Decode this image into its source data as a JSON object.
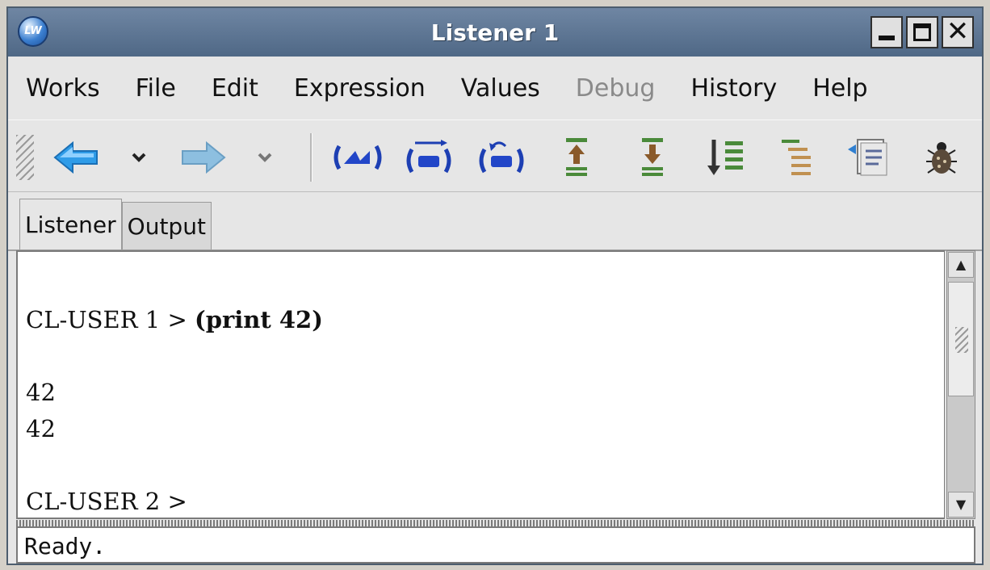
{
  "window": {
    "title": "Listener 1",
    "app_icon": "lw-icon"
  },
  "menubar": {
    "items": [
      {
        "label": "Works"
      },
      {
        "label": "File"
      },
      {
        "label": "Edit"
      },
      {
        "label": "Expression"
      },
      {
        "label": "Values"
      },
      {
        "label": "Debug",
        "disabled": true
      },
      {
        "label": "History"
      },
      {
        "label": "Help"
      }
    ]
  },
  "toolbar": {
    "icons": [
      "back-arrow-icon",
      "back-history-dropdown-icon",
      "forward-arrow-icon",
      "forward-history-dropdown-icon",
      "evaluate-icon",
      "macroexpand-icon",
      "return-value-icon",
      "previous-history-icon",
      "next-history-icon",
      "history-list-icon",
      "indent-icon",
      "inspect-icon",
      "debugger-bug-icon"
    ]
  },
  "tabs": [
    {
      "label": "Listener",
      "active": true
    },
    {
      "label": "Output",
      "active": false
    }
  ],
  "listener": {
    "prompt1": "CL-USER 1 > ",
    "command1": "(print 42)",
    "output_line1": "42",
    "output_line2": "42",
    "prompt2": "CL-USER 2 >"
  },
  "status": {
    "text": "Ready."
  },
  "colors": {
    "titlebar": "#5a7394",
    "arrow_blue": "#2f9ce8",
    "text_green": "#4a8a3a"
  }
}
